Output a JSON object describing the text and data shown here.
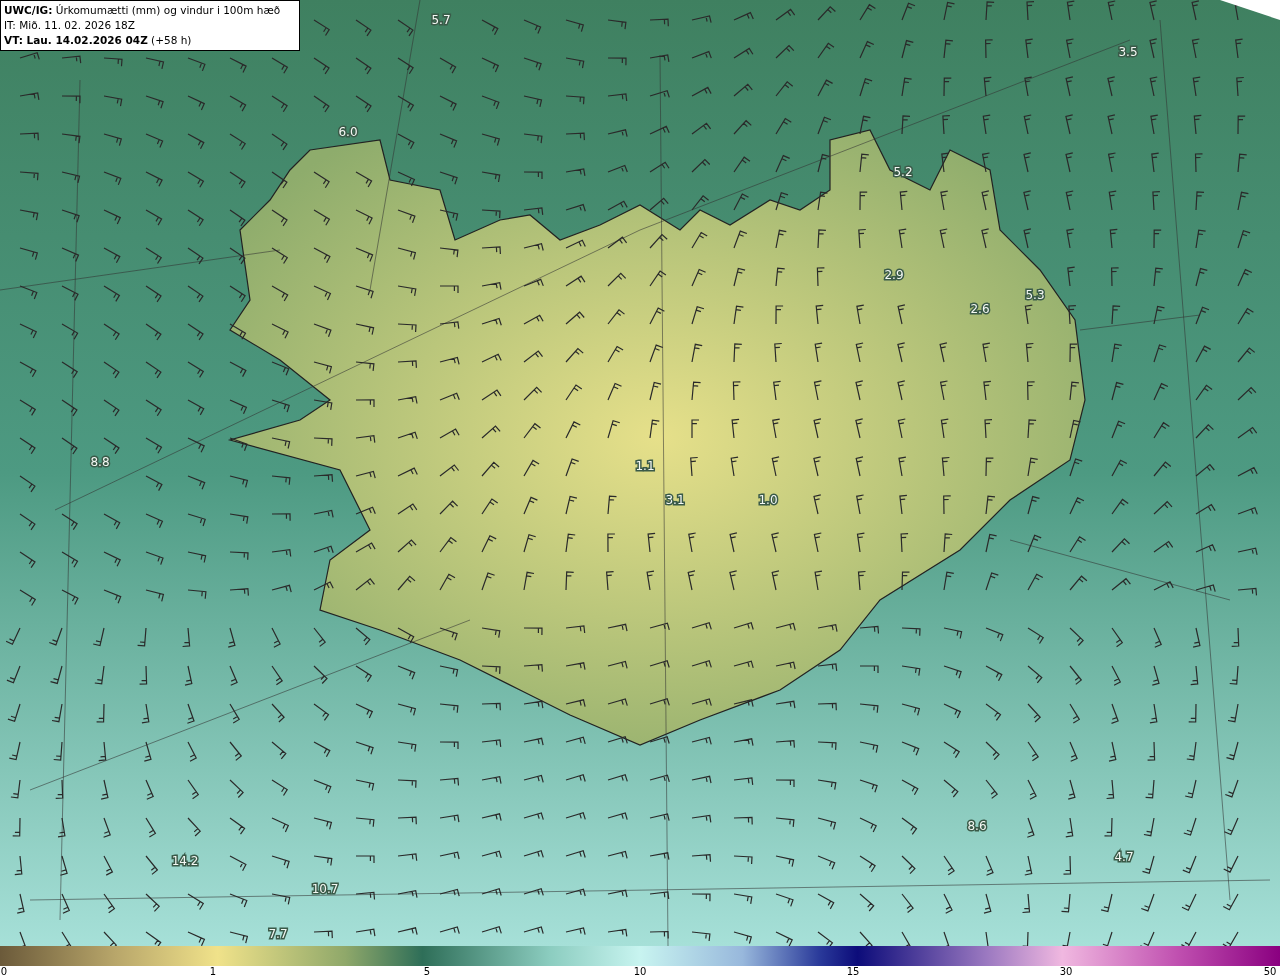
{
  "header": {
    "lines": [
      "**UWC/IG:** Úrkomumætti (mm) og vindur i 100m hæð",
      "IT: Mið. 11. 02. 2026 18Z",
      "**VT: Lau. 14.02.2026 04Z** (+58 h)"
    ]
  },
  "map": {
    "value_labels": [
      "5.7",
      "3.5",
      "6.0",
      "5.2",
      "2.9",
      "5.3",
      "2.6",
      "8.8",
      "1.1",
      "3.1",
      "1.0",
      "8.6",
      "4.7",
      "14.2",
      "10.7",
      "7.7"
    ]
  },
  "colorbar": {
    "ticks": [
      "0",
      "1",
      "5",
      "10",
      "15",
      "30",
      "50"
    ]
  }
}
